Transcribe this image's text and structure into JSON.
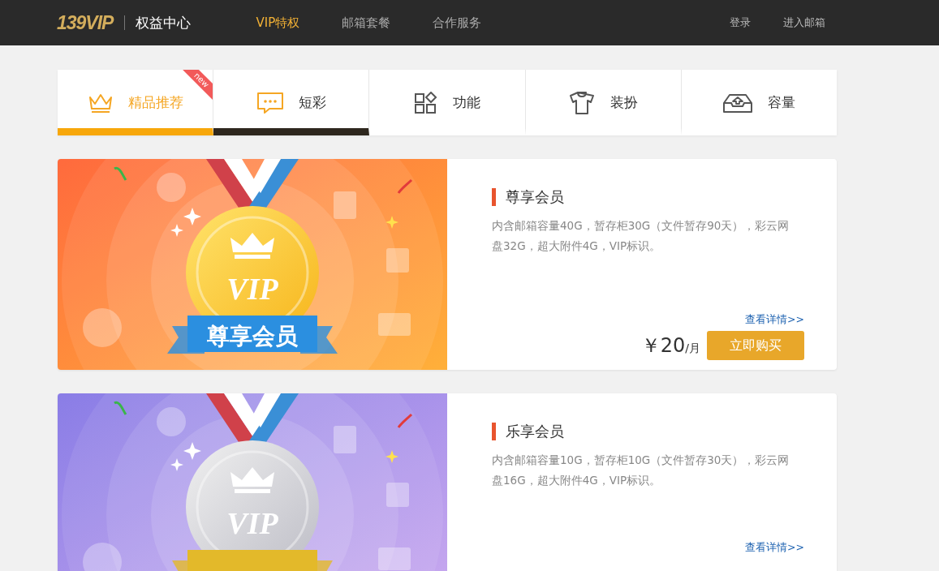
{
  "header": {
    "logo": "139VIP",
    "subtitle": "权益中心",
    "nav": [
      {
        "label": "VIP特权",
        "selected": true
      },
      {
        "label": "邮箱套餐",
        "selected": false
      },
      {
        "label": "合作服务",
        "selected": false
      }
    ],
    "links": [
      "登录",
      "进入邮箱"
    ]
  },
  "tabs": [
    {
      "label": "精品推荐",
      "selected": true,
      "hovered": false,
      "badge": "new"
    },
    {
      "label": "短彩",
      "selected": false,
      "hovered": true
    },
    {
      "label": "功能",
      "selected": false,
      "hovered": false
    },
    {
      "label": "装扮",
      "selected": false,
      "hovered": false
    },
    {
      "label": "容量",
      "selected": false,
      "hovered": false
    }
  ],
  "cards": [
    {
      "kind": "gold",
      "medal_text": "VIP",
      "ribbon_text": "尊享会员",
      "title": "尊享会员",
      "description": "内含邮箱容量40G，暂存柜30G（文件暂存90天），彩云网盘32G，超大附件4G，VIP标识。",
      "details_link": "查看详情>>",
      "price": "￥20",
      "unit": "/月",
      "buy_button": "立即购买"
    },
    {
      "kind": "silver",
      "medal_text": "VIP",
      "title": "乐享会员",
      "description": "内含邮箱容量10G，暂存柜10G（文件暂存30天），彩云网盘16G，超大附件4G，VIP标识。",
      "details_link": "查看详情>>"
    }
  ]
}
